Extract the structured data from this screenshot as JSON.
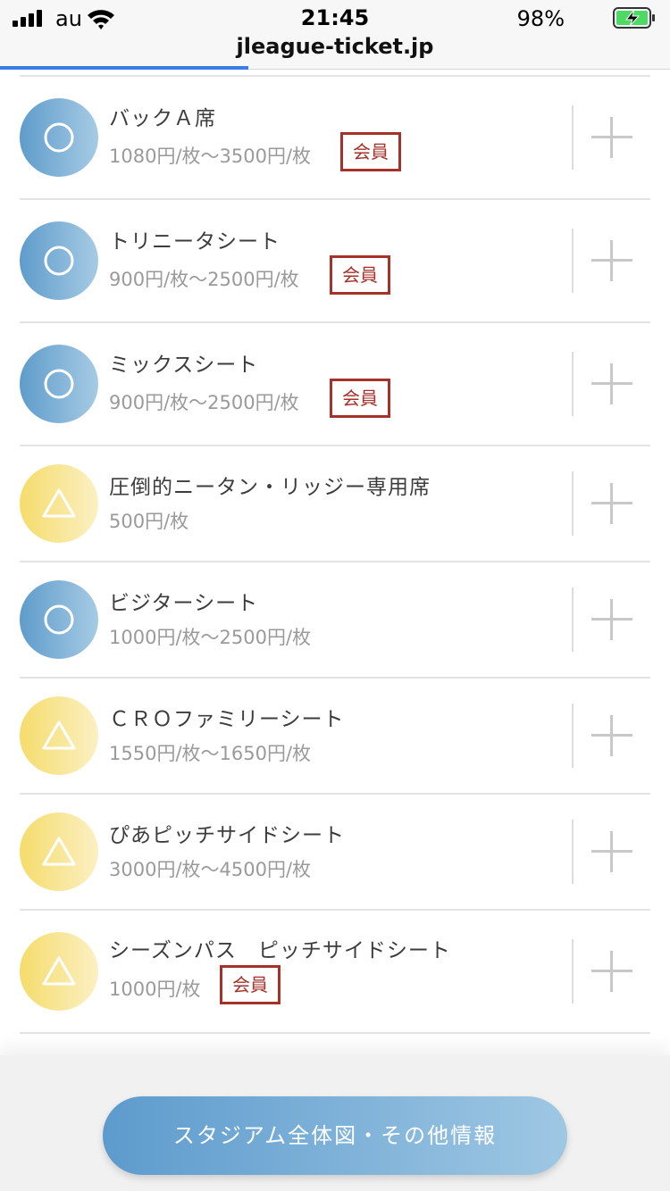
{
  "status_bar": {
    "carrier": "au",
    "time": "21:45",
    "battery_percent": "98%"
  },
  "browser": {
    "url": "jleague-ticket.jp",
    "load_progress": 0.37
  },
  "seats": [
    {
      "name": "バックＡ席",
      "price": "1080円/枚〜3500円/枚",
      "availability": "circle",
      "member_badge": "会員"
    },
    {
      "name": "トリニータシート",
      "price": "900円/枚〜2500円/枚",
      "availability": "circle",
      "member_badge": "会員"
    },
    {
      "name": "ミックスシート",
      "price": "900円/枚〜2500円/枚",
      "availability": "circle",
      "member_badge": "会員"
    },
    {
      "name": "圧倒的ニータン・リッジー専用席",
      "price": "500円/枚",
      "availability": "triangle"
    },
    {
      "name": "ビジターシート",
      "price": "1000円/枚〜2500円/枚",
      "availability": "circle"
    },
    {
      "name": "ＣＲＯファミリーシート",
      "price": "1550円/枚〜1650円/枚",
      "availability": "triangle"
    },
    {
      "name": "ぴあピッチサイドシート",
      "price": "3000円/枚〜4500円/枚",
      "availability": "triangle"
    },
    {
      "name": "シーズンパス　ピッチサイドシート",
      "price": "1000円/枚",
      "availability": "triangle",
      "member_badge": "会員"
    }
  ],
  "footer": {
    "button_label": "スタジアム全体図・その他情報"
  },
  "colors": {
    "circle_badge": "#5f9ccb",
    "triangle_badge": "#f5dc6c",
    "member_border": "#a6302a",
    "progress": "#3d7be8"
  }
}
